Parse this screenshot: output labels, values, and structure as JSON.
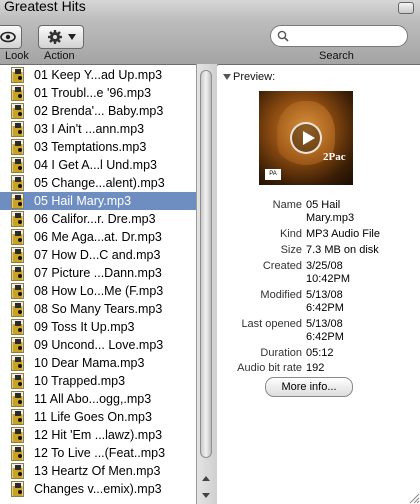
{
  "window": {
    "title": "Greatest Hits"
  },
  "toolbar": {
    "look_label": "Look",
    "action_label": "Action",
    "search_label": "Search",
    "search_placeholder": ""
  },
  "files": [
    "01 Keep Y...ad Up.mp3",
    "01 Troubl...e '96.mp3",
    "02 Brenda'... Baby.mp3",
    "03 I Ain't ...ann.mp3",
    "03 Temptations.mp3",
    "04 I Get A...l Und.mp3",
    "05 Change...alent).mp3",
    "05 Hail Mary.mp3",
    "06 Califor...r. Dre.mp3",
    "06 Me Aga...at. Dr.mp3",
    "07 How D...C and.mp3",
    "07 Picture ...Dann.mp3",
    "08 How Lo...Me (F.mp3",
    "08 So Many Tears.mp3",
    "09 Toss It Up.mp3",
    "09 Uncond... Love.mp3",
    "10 Dear Mama.mp3",
    "10 Trapped.mp3",
    "11 All Abo...ogg,.mp3",
    "11 Life Goes On.mp3",
    "12 Hit 'Em ...lawz).mp3",
    "12 To Live ...(Feat..mp3",
    "13 Heartz Of Men.mp3",
    "Changes v...emix).mp3"
  ],
  "selected_file": "05 Hail Mary.mp3",
  "preview": {
    "label": "Preview:",
    "album_art_text": "2Pac",
    "advisory_text": "PA",
    "fields": [
      {
        "key": "Name",
        "value": "05 Hail Mary.mp3"
      },
      {
        "key": "Kind",
        "value": "MP3 Audio File"
      },
      {
        "key": "Size",
        "value": "7.3 MB on disk"
      },
      {
        "key": "Created",
        "value": "3/25/08 10:42PM"
      },
      {
        "key": "Modified",
        "value": "5/13/08 6:42PM"
      },
      {
        "key": "Last opened",
        "value": "5/13/08 6:42PM"
      },
      {
        "key": "Duration",
        "value": "05:12"
      },
      {
        "key": "Audio bit rate",
        "value": "192"
      }
    ],
    "more_info_label": "More info..."
  },
  "colors": {
    "selection": "#6e8ec1",
    "toolbar": "#b4b4b4"
  }
}
